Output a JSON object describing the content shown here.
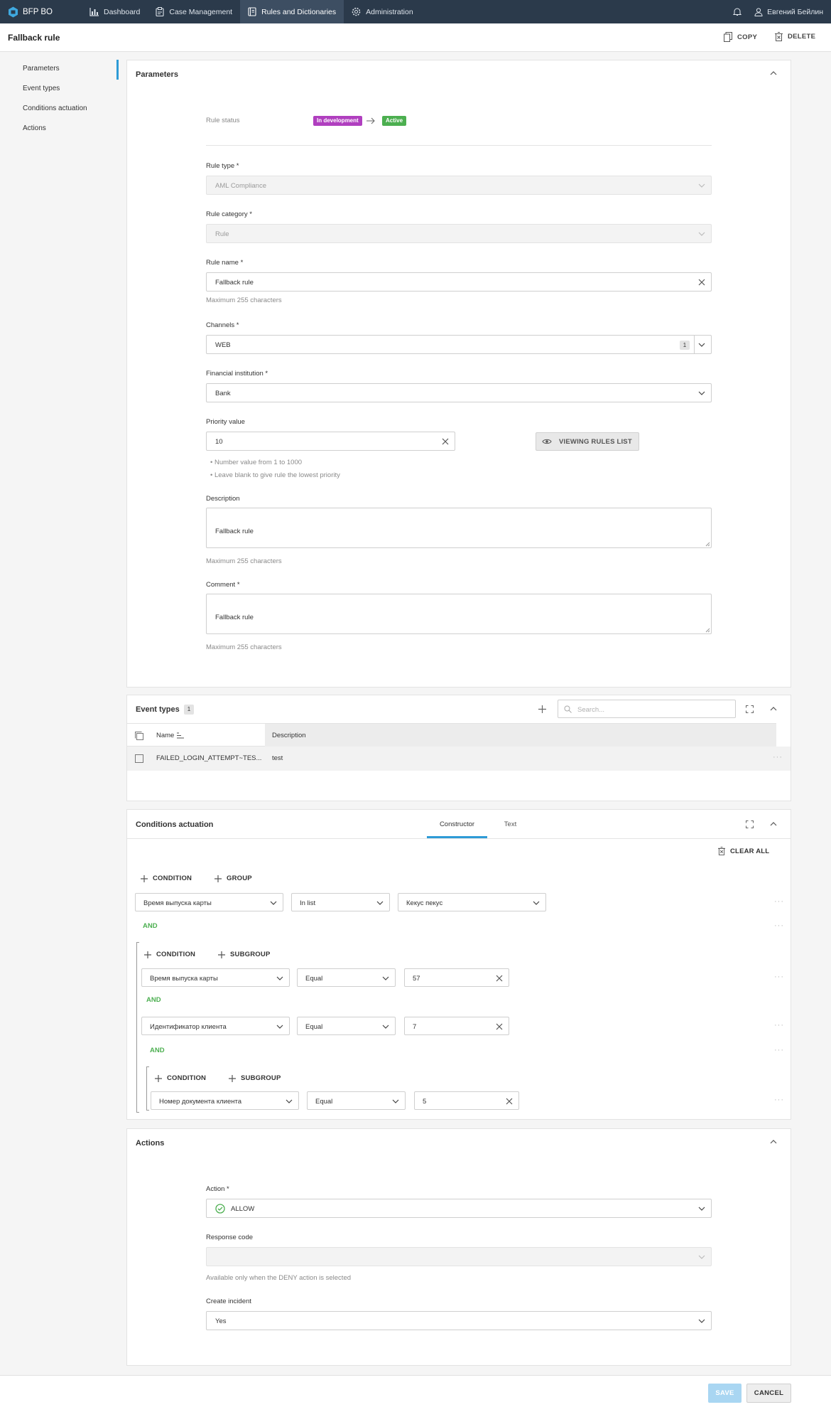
{
  "app": {
    "name": "BFP BO"
  },
  "nav": [
    {
      "label": "Dashboard",
      "icon": "bar-chart-icon"
    },
    {
      "label": "Case Management",
      "icon": "clipboard-icon"
    },
    {
      "label": "Rules and Dictionaries",
      "icon": "book-icon",
      "active": true
    },
    {
      "label": "Administration",
      "icon": "gear-icon"
    }
  ],
  "user": {
    "name": "Евгений Бейлин"
  },
  "page": {
    "title": "Fallback rule",
    "copy_label": "COPY",
    "delete_label": "DELETE"
  },
  "sidebar": {
    "items": [
      "Parameters",
      "Event types",
      "Conditions actuation",
      "Actions"
    ]
  },
  "parameters": {
    "title": "Parameters",
    "rule_status_label": "Rule status",
    "status_from": "In development",
    "status_to": "Active",
    "rule_type_label": "Rule type *",
    "rule_type_value": "AML Compliance",
    "rule_category_label": "Rule category *",
    "rule_category_value": "Rule",
    "rule_name_label": "Rule name *",
    "rule_name_value": "Fallback rule",
    "rule_name_hint": "Maximum 255 characters",
    "channels_label": "Channels *",
    "channels_value": "WEB",
    "channels_count": "1",
    "fi_label": "Financial institution *",
    "fi_value": "Bank",
    "priority_label": "Priority value",
    "priority_value": "10",
    "viewing_rules_label": "VIEWING RULES LIST",
    "priority_hint_1": "Number value from 1 to 1000",
    "priority_hint_2": "Leave blank to give rule the lowest priority",
    "description_label": "Description",
    "description_value": "Fallback rule",
    "description_hint": "Maximum 255 characters",
    "comment_label": "Comment *",
    "comment_value": "Fallback rule",
    "comment_hint": "Maximum 255 characters"
  },
  "event_types": {
    "title": "Event types",
    "count": "1",
    "search_placeholder": "Search...",
    "columns": [
      "Name",
      "Description"
    ],
    "rows": [
      {
        "name": "FAILED_LOGIN_ATTEMPT~TES...",
        "description": "test"
      }
    ]
  },
  "conditions": {
    "title": "Conditions actuation",
    "tabs": [
      "Constructor",
      "Text"
    ],
    "clear_all": "CLEAR ALL",
    "condition_label": "CONDITION",
    "group_label": "GROUP",
    "subgroup_label": "SUBGROUP",
    "and_label": "AND",
    "rows": [
      {
        "field": "Время выпуска карты",
        "op": "In list",
        "value": "Кекус пекус"
      },
      {
        "field": "Время выпуска карты",
        "op": "Equal",
        "value": "57"
      },
      {
        "field": "Идентификатор клиента",
        "op": "Equal",
        "value": "7"
      },
      {
        "field": "Номер документа клиента",
        "op": "Equal",
        "value": "5"
      }
    ]
  },
  "actions": {
    "title": "Actions",
    "action_label": "Action *",
    "action_value": "ALLOW",
    "response_label": "Response code",
    "response_value": "",
    "response_hint": "Available only when the DENY action is selected",
    "incident_label": "Create incident",
    "incident_value": "Yes"
  },
  "footer": {
    "save": "SAVE",
    "cancel": "CANCEL"
  },
  "colors": {
    "topbar": "#2b3a4b",
    "accent": "#2e9bd6",
    "in_development": "#b03fbf",
    "active": "#4caf50"
  }
}
